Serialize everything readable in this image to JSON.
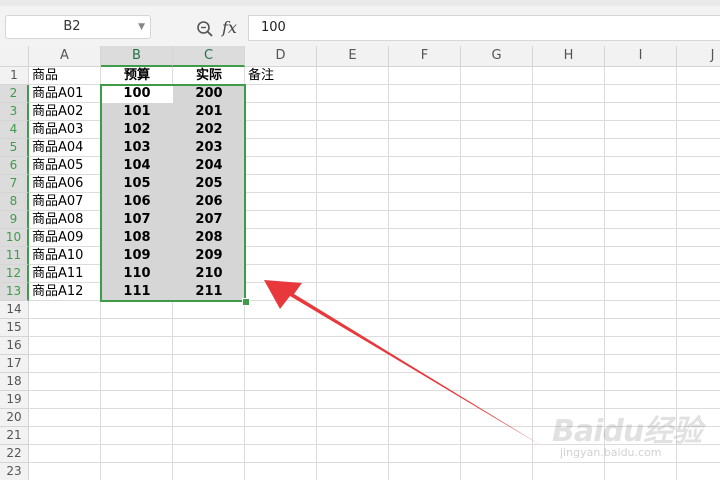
{
  "formula_bar": {
    "name_box": "B2",
    "fx_label": "fx",
    "formula_value": "100"
  },
  "columns": [
    "A",
    "B",
    "C",
    "D",
    "E",
    "F",
    "G",
    "H",
    "I",
    "J"
  ],
  "rows": [
    "1",
    "2",
    "3",
    "4",
    "5",
    "6",
    "7",
    "8",
    "9",
    "10",
    "11",
    "12",
    "13",
    "14",
    "15",
    "16",
    "17",
    "18",
    "19",
    "20",
    "21",
    "22",
    "23"
  ],
  "sheet": {
    "headers": {
      "a": "商品",
      "b": "预算",
      "c": "实际",
      "d": "备注"
    },
    "data": [
      {
        "a": "商品A01",
        "b": "100",
        "c": "200"
      },
      {
        "a": "商品A02",
        "b": "101",
        "c": "201"
      },
      {
        "a": "商品A03",
        "b": "102",
        "c": "202"
      },
      {
        "a": "商品A04",
        "b": "103",
        "c": "203"
      },
      {
        "a": "商品A05",
        "b": "104",
        "c": "204"
      },
      {
        "a": "商品A06",
        "b": "105",
        "c": "205"
      },
      {
        "a": "商品A07",
        "b": "106",
        "c": "206"
      },
      {
        "a": "商品A08",
        "b": "107",
        "c": "207"
      },
      {
        "a": "商品A09",
        "b": "108",
        "c": "208"
      },
      {
        "a": "商品A10",
        "b": "109",
        "c": "209"
      },
      {
        "a": "商品A11",
        "b": "110",
        "c": "210"
      },
      {
        "a": "商品A12",
        "b": "111",
        "c": "211"
      }
    ]
  },
  "selection": {
    "range": "B2:C13",
    "accent": "#3f9b4a"
  },
  "annotation": {
    "arrow_color": "#e8383b"
  },
  "watermark": {
    "brand": "Baidu经验",
    "url": "jingyan.baidu.com"
  }
}
